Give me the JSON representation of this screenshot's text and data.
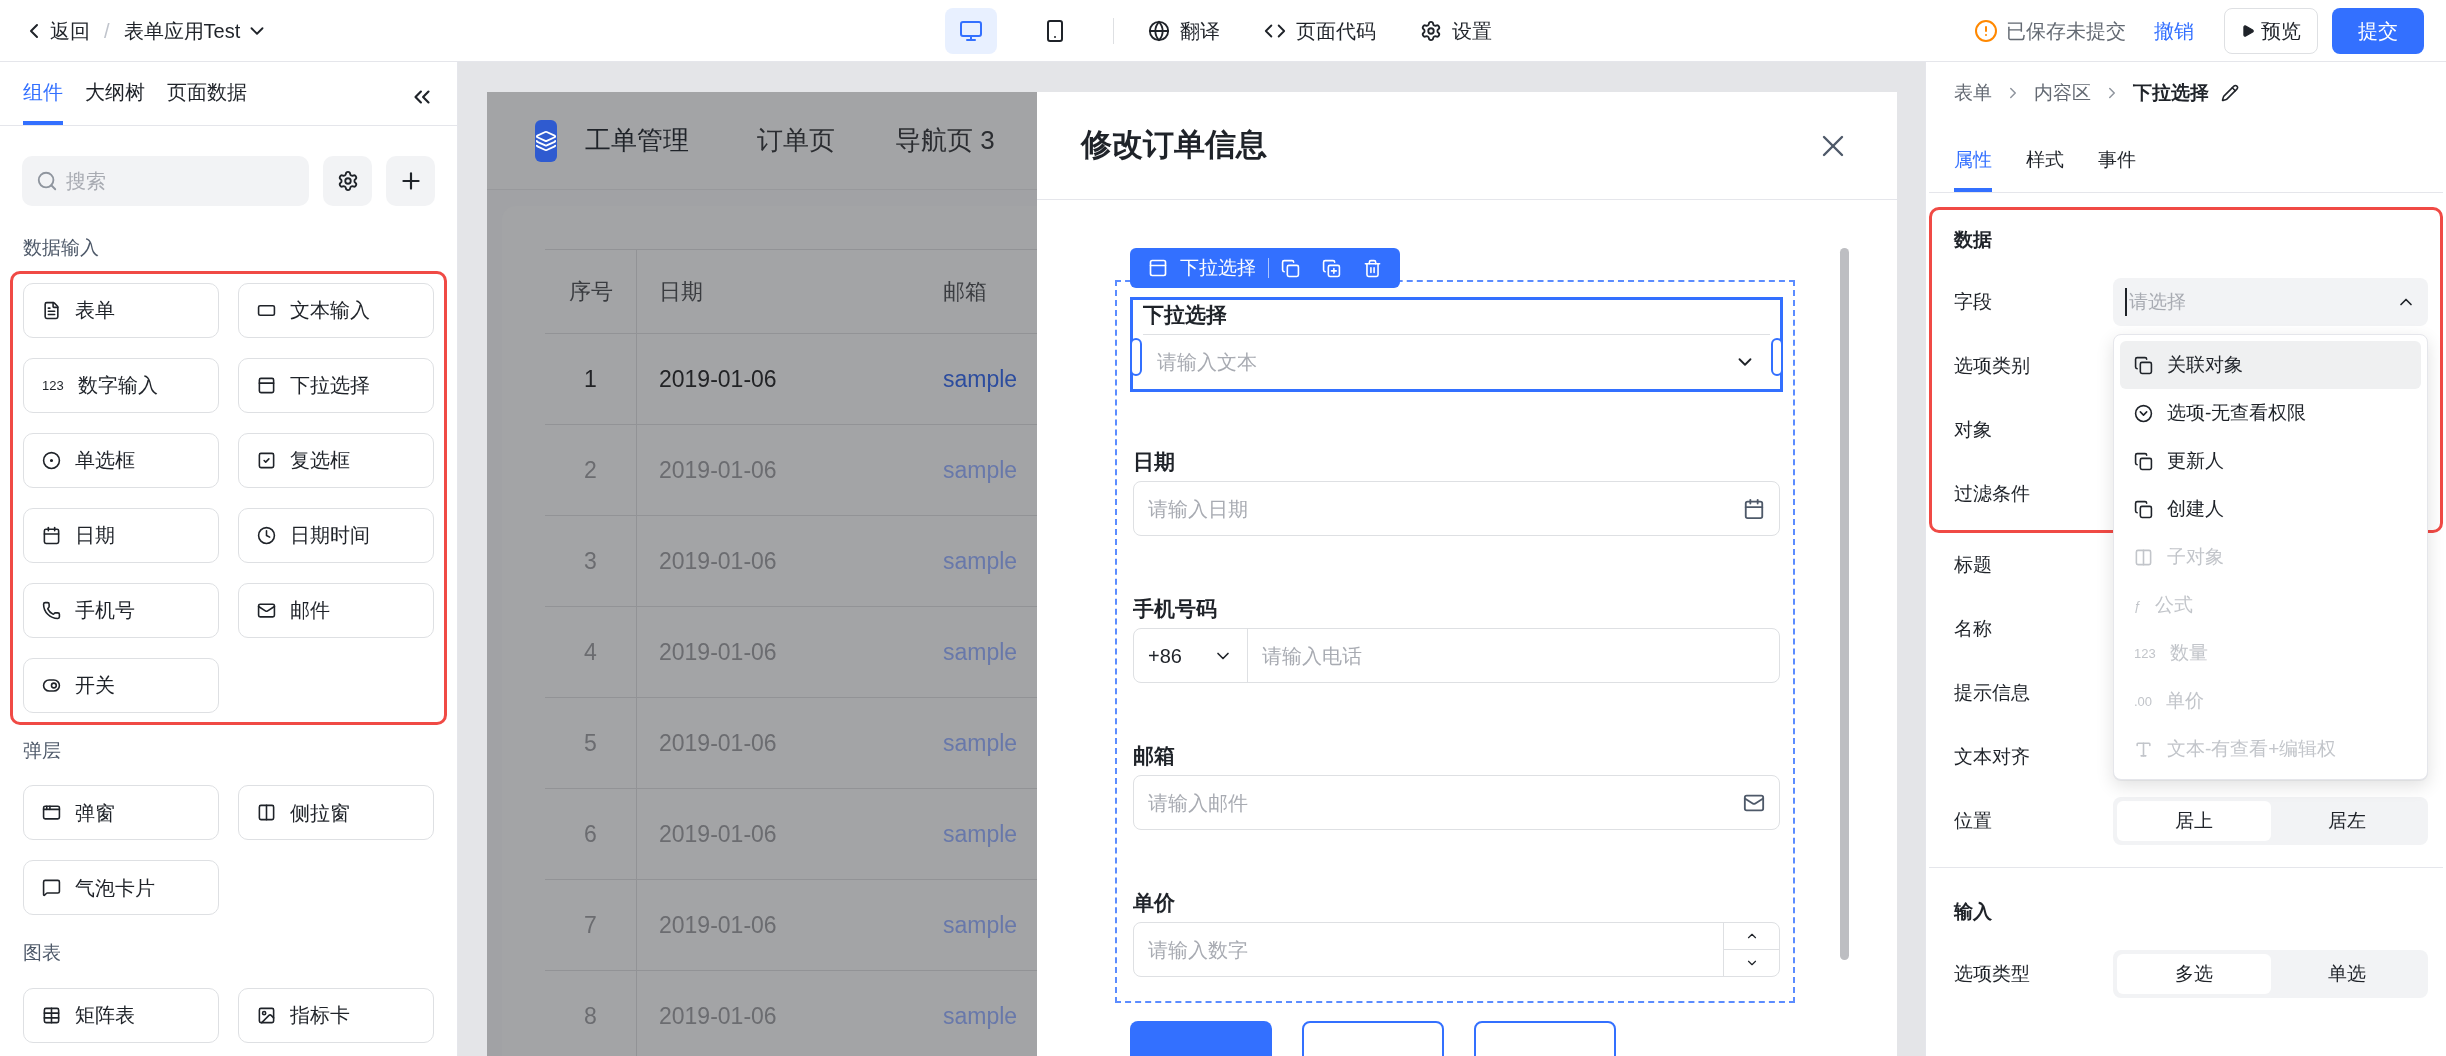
{
  "top_bar": {
    "back": "返回",
    "separator": "/",
    "app_name": "表单应用Test",
    "device_modes": [
      {
        "kind": "desktop",
        "selected": true
      },
      {
        "kind": "mobile",
        "selected": false
      }
    ],
    "tools": [
      {
        "kind": "translate",
        "label": "翻译"
      },
      {
        "kind": "code",
        "label": "页面代码"
      },
      {
        "kind": "settings",
        "label": "设置"
      }
    ],
    "save_status": "已保存未提交",
    "undo": "撤销",
    "preview": "预览",
    "submit": "提交"
  },
  "left_panel": {
    "tabs": [
      {
        "label": "组件",
        "selected": true
      },
      {
        "label": "大纲树",
        "selected": false
      },
      {
        "label": "页面数据",
        "selected": false
      }
    ],
    "search": {
      "placeholder": "搜索"
    },
    "groups": [
      {
        "title": "数据输入",
        "highlighted": true,
        "items": [
          {
            "label": "表单",
            "kind": "form"
          },
          {
            "label": "文本输入",
            "kind": "text_input"
          },
          {
            "label": "数字输入",
            "kind": "glyph",
            "icon_text": "123"
          },
          {
            "label": "下拉选择",
            "kind": "select"
          },
          {
            "label": "单选框",
            "kind": "radio"
          },
          {
            "label": "复选框",
            "kind": "checkbox"
          },
          {
            "label": "日期",
            "kind": "date"
          },
          {
            "label": "日期时间",
            "kind": "datetime"
          },
          {
            "label": "手机号",
            "kind": "phone"
          },
          {
            "label": "邮件",
            "kind": "mail"
          },
          {
            "label": "开关",
            "kind": "switch"
          }
        ]
      },
      {
        "title": "弹层",
        "items": [
          {
            "label": "弹窗",
            "kind": "modal"
          },
          {
            "label": "侧拉窗",
            "kind": "drawer"
          },
          {
            "label": "气泡卡片",
            "kind": "bubble"
          }
        ]
      },
      {
        "title": "图表",
        "items": [
          {
            "label": "矩阵表",
            "kind": "matrix"
          },
          {
            "label": "指标卡",
            "kind": "metric"
          }
        ]
      }
    ]
  },
  "canvas": {
    "app_title": "工单管理",
    "nav": [
      "订单页",
      "导航页 3"
    ],
    "table": {
      "columns": [
        "序号",
        "日期",
        "邮箱"
      ],
      "rows": [
        {
          "cells": [
            "1",
            "2019-01-06",
            "sample"
          ],
          "selected": true
        },
        {
          "cells": [
            "2",
            "2019-01-06",
            "sample"
          ],
          "selected": false
        },
        {
          "cells": [
            "3",
            "2019-01-06",
            "sample"
          ],
          "selected": false
        },
        {
          "cells": [
            "4",
            "2019-01-06",
            "sample"
          ],
          "selected": false
        },
        {
          "cells": [
            "5",
            "2019-01-06",
            "sample"
          ],
          "selected": false
        },
        {
          "cells": [
            "6",
            "2019-01-06",
            "sample"
          ],
          "selected": false
        },
        {
          "cells": [
            "7",
            "2019-01-06",
            "sample"
          ],
          "selected": false
        },
        {
          "cells": [
            "8",
            "2019-01-06",
            "sample"
          ],
          "selected": false
        }
      ]
    },
    "drawer": {
      "title": "修改订单信息",
      "toolbar": {
        "label": "下拉选择"
      },
      "fields": [
        {
          "kind": "select",
          "label": "下拉选择",
          "placeholder": "请输入文本",
          "selected": true
        },
        {
          "kind": "date",
          "label": "日期",
          "placeholder": "请输入日期",
          "selected": false
        },
        {
          "kind": "phone",
          "label": "手机号码",
          "prefix": "+86",
          "placeholder": "请输入电话",
          "selected": false
        },
        {
          "kind": "email",
          "label": "邮箱",
          "placeholder": "请输入邮件",
          "selected": false
        },
        {
          "kind": "number",
          "label": "单价",
          "placeholder": "请输入数字",
          "selected": false
        }
      ],
      "footer_buttons": [
        {
          "kind": "primary"
        },
        {
          "kind": "outline"
        },
        {
          "kind": "outline"
        }
      ]
    }
  },
  "properties": {
    "breadcrumb": [
      "表单",
      "内容区",
      "下拉选择"
    ],
    "tabs": [
      {
        "label": "属性",
        "selected": true
      },
      {
        "label": "样式",
        "selected": false
      },
      {
        "label": "事件",
        "selected": false
      }
    ],
    "sections": [
      {
        "title": "数据",
        "highlighted": true,
        "rows": [
          {
            "label": "字段",
            "kind": "select",
            "placeholder": "请选择",
            "expanded": true,
            "options": [
              {
                "label": "关联对象",
                "kind": "link",
                "highlighted": true,
                "disabled": false
              },
              {
                "label": "选项-无查看权限",
                "kind": "option",
                "highlighted": false,
                "disabled": false
              },
              {
                "label": "更新人",
                "kind": "link",
                "highlighted": false,
                "disabled": false
              },
              {
                "label": "创建人",
                "kind": "link",
                "highlighted": false,
                "disabled": false
              },
              {
                "label": "子对象",
                "kind": "sub",
                "highlighted": false,
                "disabled": true
              },
              {
                "label": "公式",
                "kind": "glyph",
                "icon_text": "ƒ",
                "highlighted": false,
                "disabled": true
              },
              {
                "label": "数量",
                "kind": "glyph",
                "icon_text": "123",
                "highlighted": false,
                "disabled": true
              },
              {
                "label": "单价",
                "kind": "glyph",
                "icon_text": ".00",
                "highlighted": false,
                "disabled": true
              },
              {
                "label": "文本-有查看+编辑权",
                "kind": "text",
                "highlighted": false,
                "disabled": true
              }
            ]
          },
          {
            "label": "选项类别",
            "kind": "covered"
          },
          {
            "label": "对象",
            "kind": "covered"
          },
          {
            "label": "过滤条件",
            "kind": "covered"
          }
        ]
      },
      {
        "rows": [
          {
            "label": "标题",
            "kind": "covered"
          },
          {
            "label": "名称",
            "kind": "covered"
          },
          {
            "label": "提示信息",
            "kind": "covered"
          },
          {
            "label": "文本对齐",
            "kind": "covered_segmented"
          },
          {
            "label": "位置",
            "kind": "segmented",
            "options": [
              {
                "label": "居上",
                "selected": true
              },
              {
                "label": "居左",
                "selected": false
              }
            ]
          }
        ]
      },
      {
        "title": "输入",
        "rows": [
          {
            "label": "选项类型",
            "kind": "segmented",
            "options": [
              {
                "label": "多选",
                "selected": true
              },
              {
                "label": "单选",
                "selected": false
              }
            ]
          }
        ]
      }
    ]
  }
}
